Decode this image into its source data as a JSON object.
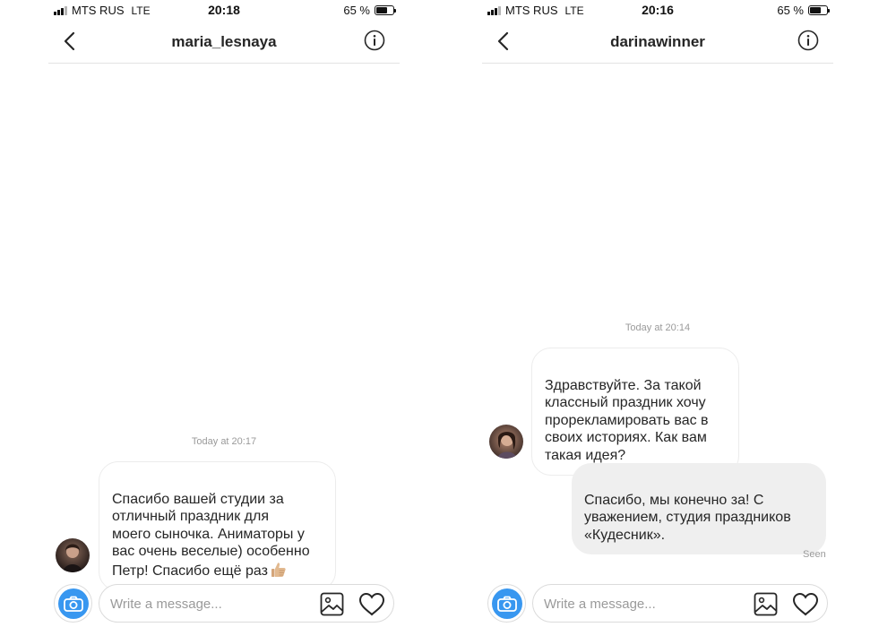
{
  "left_screen": {
    "status": {
      "carrier": "MTS RUS",
      "network": "LTE",
      "time": "20:18",
      "battery": "65 %",
      "battery_level": 0.65
    },
    "header": {
      "username": "maria_lesnaya"
    },
    "thread": {
      "timestamp": "Today at 20:17",
      "messages": [
        {
          "direction": "incoming",
          "text": "Спасибо вашей студии за\nотличный праздник для\nмоего сыночка. Аниматоры у\nвас очень веселые) особенно\nПетр! Спасибо ещё раз",
          "emoji": "thumbs-up"
        }
      ]
    },
    "composer": {
      "placeholder": "Write a message..."
    }
  },
  "right_screen": {
    "status": {
      "carrier": "MTS RUS",
      "network": "LTE",
      "time": "20:16",
      "battery": "65 %",
      "battery_level": 0.65
    },
    "header": {
      "username": "darinawinner"
    },
    "thread": {
      "timestamp": "Today at 20:14",
      "messages": [
        {
          "direction": "incoming",
          "text": "Здравствуйте. За такой\nклассный праздник хочу\nпрорекламировать вас в\nсвоих историях. Как вам\nтакая идея?"
        },
        {
          "direction": "outgoing",
          "text": "Спасибо, мы конечно за! С\nуважением, студия праздников\n«Кудесник»."
        }
      ],
      "seen": "Seen"
    },
    "composer": {
      "placeholder": "Write a message..."
    }
  },
  "colors": {
    "accent": "#3897f0",
    "bubble_out": "#efefef",
    "muted_text": "#9a9a9a"
  }
}
